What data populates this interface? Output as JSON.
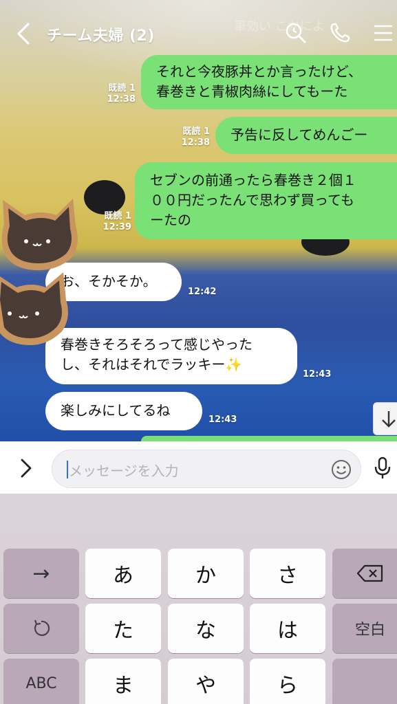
{
  "header": {
    "title": "チーム夫婦 (2)",
    "hint": "筆効い こかによ",
    "icons": {
      "back": "chevron-left-icon",
      "search": "search-icon",
      "call": "phone-icon",
      "menu": "menu-icon"
    }
  },
  "messages": [
    {
      "side": "right",
      "text": "それと今夜豚丼とか言ったけど、\n春巻きと青椒肉絲にしてもーた",
      "read": "既読 1",
      "time": "12:38"
    },
    {
      "side": "right",
      "text": "予告に反してめんごー",
      "read": "既読 1",
      "time": "12:38"
    },
    {
      "side": "right",
      "text": "セブンの前通ったら春巻き２個１\n００円だったんで思わず買っても\nーたの",
      "read": "既読 1",
      "time": "12:39"
    },
    {
      "side": "left",
      "text": "お、そかそか。",
      "time": "12:42"
    },
    {
      "side": "left",
      "text": "春巻きそろそろって感じやった\nし、それはそれでラッキー✨",
      "time": "12:43"
    },
    {
      "side": "left",
      "text": "楽しみにしてるね",
      "time": "12:43"
    }
  ],
  "input": {
    "placeholder": "メッセージを入力"
  },
  "keyboard": {
    "rows": [
      [
        "→",
        "あ",
        "か",
        "さ",
        "⌫"
      ],
      [
        "↺",
        "た",
        "な",
        "は",
        "空白"
      ],
      [
        "ABC",
        "ま",
        "や",
        "ら",
        ""
      ]
    ]
  },
  "colors": {
    "sent_bubble": "#79e175",
    "received_bubble": "#ffffff",
    "keyboard_bg": "#d8cfd6",
    "func_key": "#b9a8b7"
  }
}
